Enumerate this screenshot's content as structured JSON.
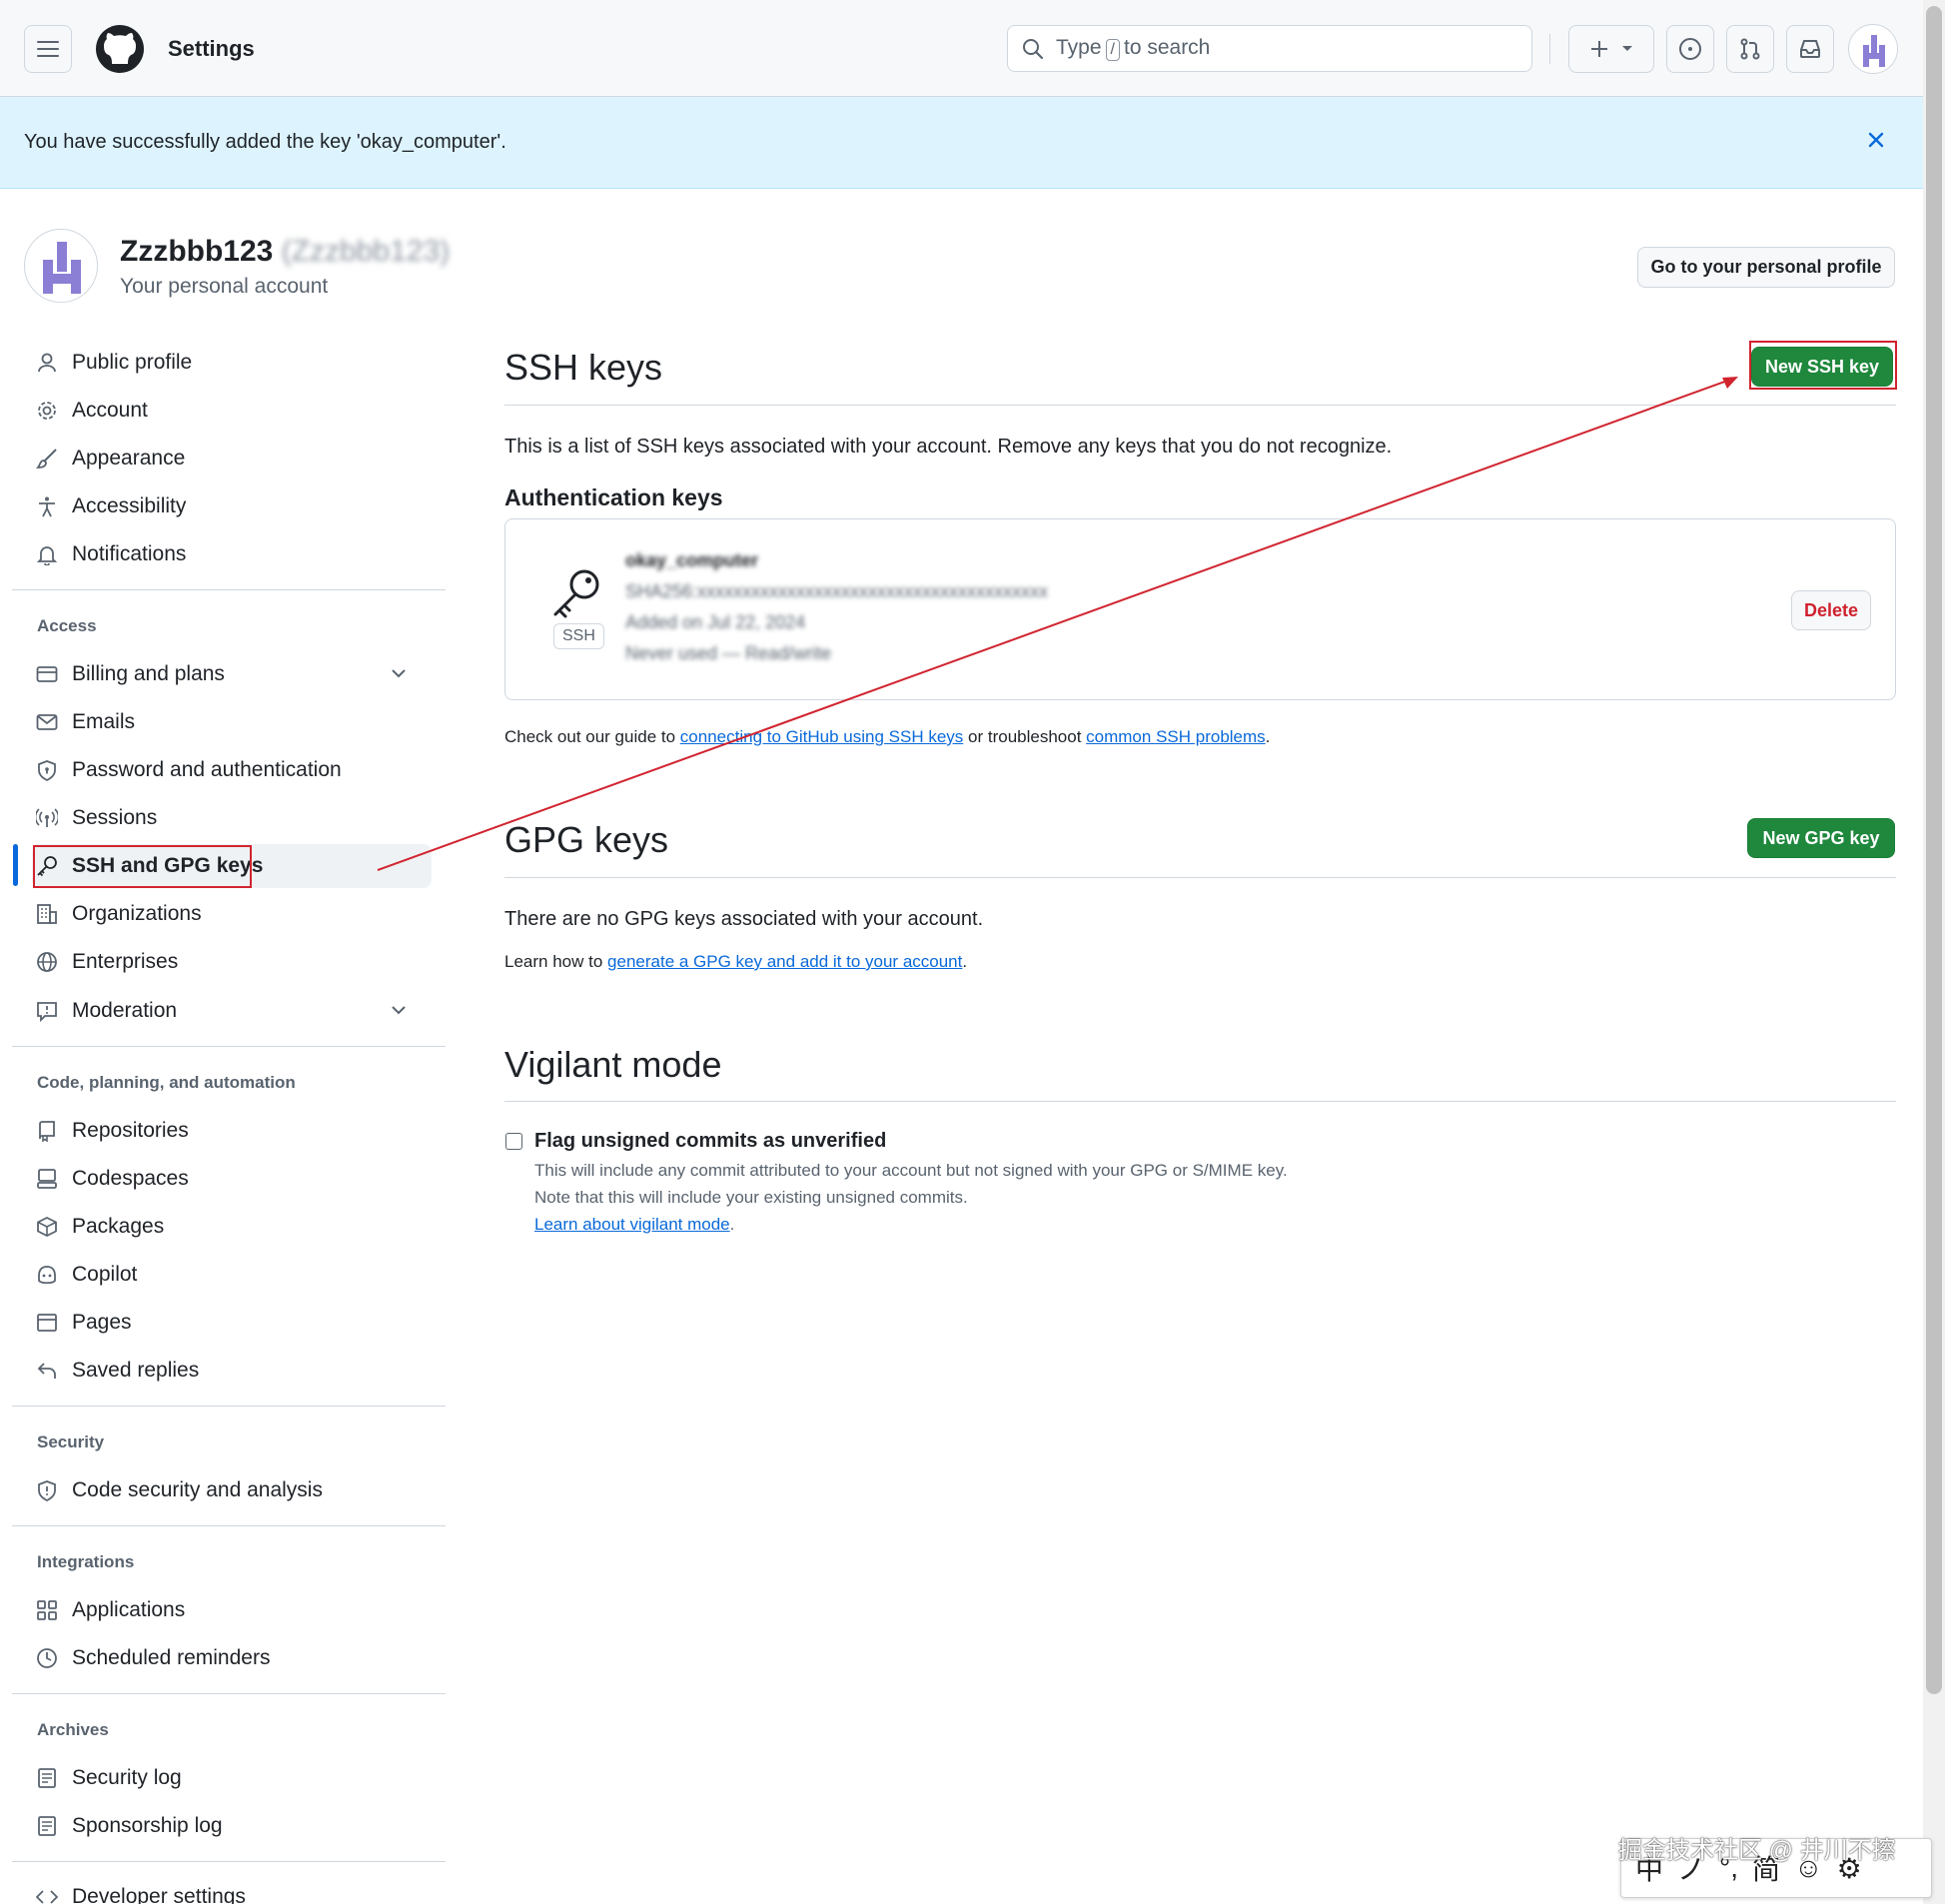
{
  "header": {
    "title": "Settings",
    "search_prefix": "Type",
    "search_key": "/",
    "search_suffix": "to search"
  },
  "flash": {
    "message": "You have successfully added the key 'okay_computer'."
  },
  "profile": {
    "name": "Zzzbbb123",
    "login": "(Zzzbbb123)",
    "subtitle": "Your personal account",
    "go_profile_label": "Go to your personal profile"
  },
  "sidebar": {
    "top_items": [
      {
        "label": "Public profile",
        "icon": "person-icon"
      },
      {
        "label": "Account",
        "icon": "gear-icon"
      },
      {
        "label": "Appearance",
        "icon": "paintbrush-icon"
      },
      {
        "label": "Accessibility",
        "icon": "accessibility-icon"
      },
      {
        "label": "Notifications",
        "icon": "bell-icon"
      }
    ],
    "access_heading": "Access",
    "access_items": [
      {
        "label": "Billing and plans",
        "icon": "credit-card-icon"
      },
      {
        "label": "Emails",
        "icon": "mail-icon"
      },
      {
        "label": "Password and authentication",
        "icon": "shield-lock-icon"
      },
      {
        "label": "Sessions",
        "icon": "broadcast-icon"
      },
      {
        "label": "SSH and GPG keys",
        "icon": "key-icon"
      },
      {
        "label": "Organizations",
        "icon": "organization-icon"
      },
      {
        "label": "Enterprises",
        "icon": "globe-icon"
      },
      {
        "label": "Moderation",
        "icon": "report-icon"
      }
    ],
    "code_heading": "Code, planning, and automation",
    "code_items": [
      {
        "label": "Repositories",
        "icon": "repo-icon"
      },
      {
        "label": "Codespaces",
        "icon": "codespaces-icon"
      },
      {
        "label": "Packages",
        "icon": "package-icon"
      },
      {
        "label": "Copilot",
        "icon": "copilot-icon"
      },
      {
        "label": "Pages",
        "icon": "browser-icon"
      },
      {
        "label": "Saved replies",
        "icon": "reply-icon"
      }
    ],
    "security_heading": "Security",
    "security_items": [
      {
        "label": "Code security and analysis",
        "icon": "shield-icon"
      }
    ],
    "integrations_heading": "Integrations",
    "integrations_items": [
      {
        "label": "Applications",
        "icon": "apps-icon"
      },
      {
        "label": "Scheduled reminders",
        "icon": "clock-icon"
      }
    ],
    "archives_heading": "Archives",
    "archives_items": [
      {
        "label": "Security log",
        "icon": "log-icon"
      },
      {
        "label": "Sponsorship log",
        "icon": "log-icon"
      }
    ],
    "developer_label": "Developer settings"
  },
  "ssh": {
    "title": "SSH keys",
    "new_button": "New SSH key",
    "description": "This is a list of SSH keys associated with your account. Remove any keys that you do not recognize.",
    "auth_heading": "Authentication keys",
    "key": {
      "badge": "SSH",
      "title": "okay_computer",
      "fingerprint": "SHA256:xxxxxxxxxxxxxxxxxxxxxxxxxxxxxxxxxxxxxxx",
      "added": "Added on Jul 22, 2024",
      "usage": "Never used — Read/write",
      "delete_label": "Delete"
    },
    "guide_prefix": "Check out our guide to",
    "guide_link": "connecting to GitHub using SSH keys",
    "guide_middle": "or troubleshoot",
    "problems_link": "common SSH problems",
    "guide_suffix": "."
  },
  "gpg": {
    "title": "GPG keys",
    "new_button": "New GPG key",
    "empty": "There are no GPG keys associated with your account.",
    "learn_prefix": "Learn how to",
    "learn_link": "generate a GPG key and add it to your account",
    "learn_suffix": "."
  },
  "vigilant": {
    "title": "Vigilant mode",
    "checkbox_label": "Flag unsigned commits as unverified",
    "line1": "This will include any commit attributed to your account but not signed with your GPG or S/MIME key.",
    "line2": "Note that this will include your existing unsigned commits.",
    "learn_link": "Learn about vigilant mode",
    "learn_suffix": "."
  },
  "overlay": {
    "watermark": "掘金技术社区 @ 井川不擦",
    "ime": [
      "中",
      "ノ",
      "°,",
      "简",
      "☺",
      "⚙"
    ]
  },
  "colors": {
    "accent": "#0969da",
    "green": "#1f883d",
    "danger": "#cf222e",
    "annotation_red": "#d1242f",
    "flash_bg": "#ddf4ff"
  }
}
